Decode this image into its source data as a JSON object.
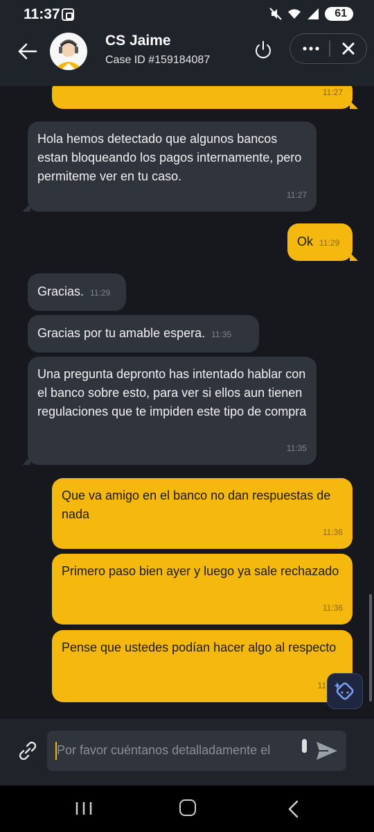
{
  "status_bar": {
    "time": "11:37",
    "battery": "61"
  },
  "header": {
    "agent_name": "CS Jaime",
    "case_id": "Case ID #159184087"
  },
  "messages": [
    {
      "side": "user",
      "text": "",
      "time": "11:27"
    },
    {
      "side": "agent",
      "text": "Hola hemos detectado que algunos bancos estan bloqueando los pagos internamente, pero permiteme ver en tu caso.",
      "time": "11:27"
    },
    {
      "side": "user",
      "text": "Ok",
      "time": "11:29"
    },
    {
      "side": "agent",
      "text": "Gracias.",
      "time": "11:29"
    },
    {
      "side": "agent",
      "text": "Gracias por tu amable espera.",
      "time": "11:35"
    },
    {
      "side": "agent",
      "text": "Una pregunta depronto has intentado hablar con el banco sobre esto, para ver si ellos aun tienen regulaciones que te impiden este tipo de compra",
      "time": "11:35"
    },
    {
      "side": "user",
      "text": "Que va amigo en el banco no dan respuestas de nada",
      "time": "11:36"
    },
    {
      "side": "user",
      "text": "Primero paso bien ayer y luego ya sale rechazado",
      "time": "11:36"
    },
    {
      "side": "user",
      "text": "Pense que ustedes podían hacer algo al respecto",
      "time": "11"
    }
  ],
  "composer": {
    "placeholder": "Por favor cuéntanos detalladamente el"
  },
  "colors": {
    "header_bg": "#1f232a",
    "chat_bg": "#16181d",
    "agent_bubble": "#2f343d",
    "user_bubble": "#f5b80f",
    "accent": "#f5b80f"
  }
}
